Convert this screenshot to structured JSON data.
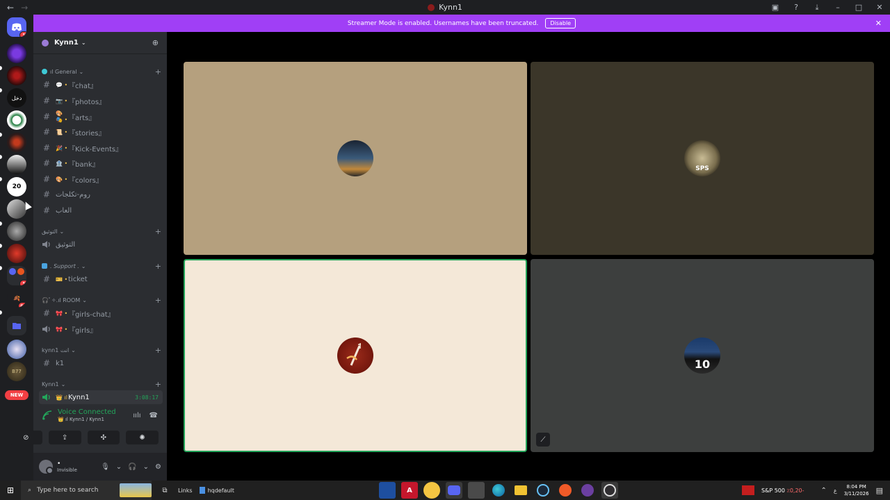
{
  "window": {
    "title": "Kynn1",
    "back_glyph": "←",
    "forward_glyph": "→",
    "controls": {
      "inbox": "▣",
      "help": "?",
      "download": "⤓",
      "minimize": "–",
      "maximize": "□",
      "close": "✕"
    }
  },
  "banner": {
    "text": "Streamer Mode is enabled. Usernames have been truncated.",
    "button_label": "Disable",
    "close_glyph": "✕",
    "color": "#a03ff6"
  },
  "servers": {
    "home_badge": "5",
    "badge_a": "5",
    "badge_b": "64",
    "text_server_1": "دخل",
    "text_server_2": "20",
    "new_label": "NEW"
  },
  "guild": {
    "name": "Kynn1",
    "chevron": "⌄",
    "invite_glyph": "⊕"
  },
  "categories": [
    {
      "label": "ıl General",
      "chev": "⌄",
      "color": "#3ec9d6"
    },
    {
      "label": "التوثيق",
      "chev": "⌄",
      "color": ""
    },
    {
      "label": ". Support .",
      "chev": "⌄",
      "color": "#4aa3df"
    },
    {
      "label": "🎧ﾟ✧.ıl ROOM",
      "chev": "⌄",
      "color": ""
    },
    {
      "label": "kynn1 انت",
      "chev": "⌄",
      "color": ""
    },
    {
      "label": "Kynn1",
      "chev": "⌄",
      "color": ""
    }
  ],
  "channels": [
    {
      "emoji": "💬 •",
      "name": "『chat』"
    },
    {
      "emoji": "📷 •",
      "name": "『photos』"
    },
    {
      "emoji": "🎨🎭 •",
      "name": "『arts』"
    },
    {
      "emoji": "📜 •",
      "name": "『stories』"
    },
    {
      "emoji": "🎉 •",
      "name": "『Kick-Events』"
    },
    {
      "emoji": "🏦 •",
      "name": "『bank』"
    },
    {
      "emoji": "🎨 •",
      "name": "『colors』"
    },
    {
      "emoji": "",
      "name": "روم-تكلجات"
    },
    {
      "emoji": "",
      "name": "العاب"
    },
    {
      "emoji": "",
      "name": "التوثيق"
    },
    {
      "emoji": "🎫 •",
      "name": "ticket"
    },
    {
      "emoji": "🎀 •",
      "name": "『girls-chat』"
    },
    {
      "emoji": "🎀 •",
      "name": "『girls』"
    },
    {
      "emoji": "",
      "name": "k1"
    },
    {
      "emoji": "👑 ıl",
      "name": "Kynn1",
      "timer": "3:08:17"
    }
  ],
  "voice": {
    "title": "Voice Connected",
    "subtitle": "👑 ıl Kynn1 / Kynn1",
    "noise_glyph": "ıılı",
    "disconnect_glyph": "☎",
    "buttons": [
      "⊘",
      "⇪",
      "✣",
      "✺"
    ]
  },
  "user": {
    "name": "•",
    "status": "Invisible",
    "mic_glyph": "🎙",
    "headset_glyph": "🎧",
    "settings_glyph": "⚙",
    "chev": "⌄"
  },
  "tiles": [
    {
      "bg": "#b5a07e",
      "active": false,
      "avatar": "city"
    },
    {
      "bg": "#3b3629",
      "active": false,
      "avatar": "sps"
    },
    {
      "bg": "#f4e8d8",
      "active": true,
      "avatar": "fork"
    },
    {
      "bg": "#3d3f3e",
      "active": false,
      "avatar": "player",
      "mute_glyph": "⟋"
    }
  ],
  "taskbar": {
    "start_glyph": "⊞",
    "search_placeholder": "Type here to search",
    "search_glyph": "⌕",
    "taskview_glyph": "⧉",
    "links": "Links",
    "hq_label": "hqdefault",
    "sp_label": "S&P 500",
    "sp_value": "٪0,20-",
    "lang": "ع",
    "tray_up": "⌃",
    "notif_glyph": "▤",
    "time": "8:04 PM",
    "date": "3/11/2026"
  },
  "colors": {
    "accent_green": "#23a55a",
    "danger": "#f23f43"
  }
}
